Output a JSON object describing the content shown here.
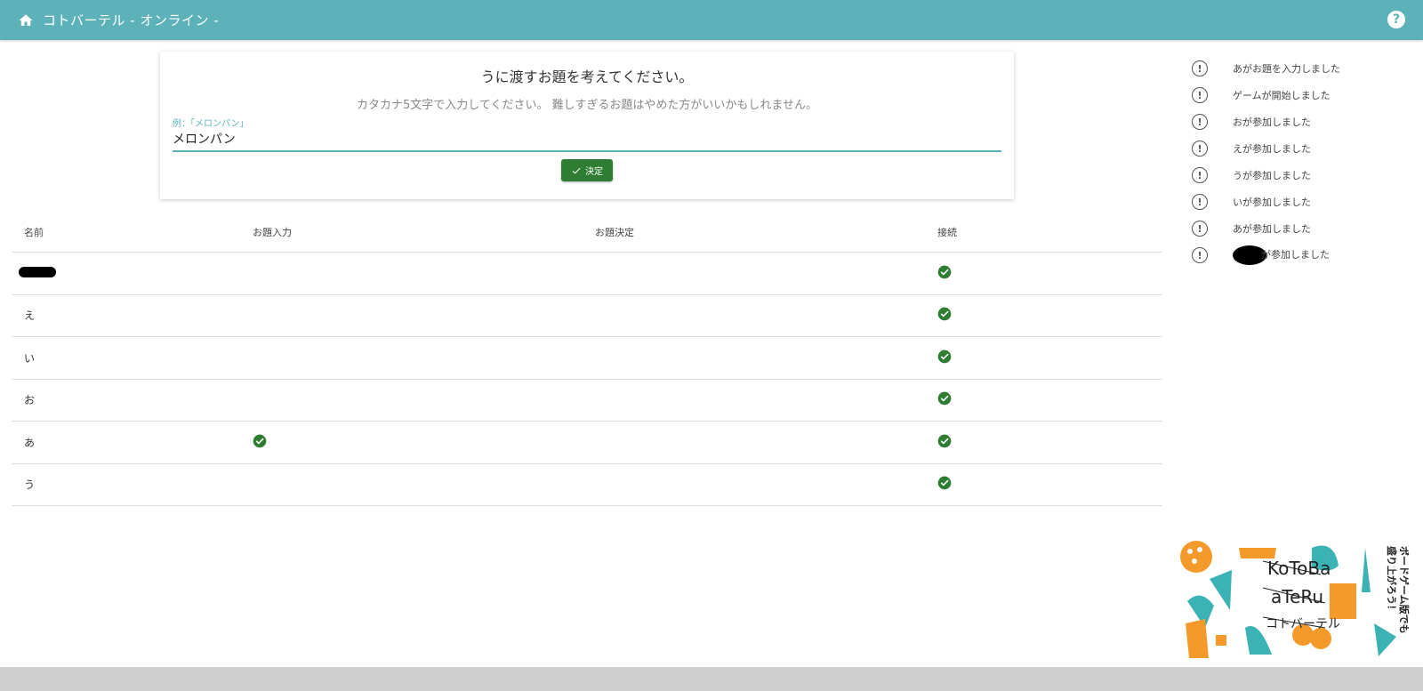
{
  "appbar": {
    "title": "コトバーテル - オンライン -",
    "home_icon": "home-icon",
    "help_icon": "help-icon",
    "help_glyph": "?"
  },
  "prompt_card": {
    "heading": "うに渡すお題を考えてください。",
    "subtext": "カタカナ5文字で入力してください。 難しすぎるお題はやめた方がいいかもしれません。",
    "field_label": "例：「メロンパン」",
    "field_value": "メロンパン",
    "submit_label": "決定"
  },
  "table": {
    "headers": [
      "名前",
      "お題入力",
      "お題決定",
      "接続"
    ],
    "rows": [
      {
        "name": "",
        "redacted": true,
        "topic_input": false,
        "topic_decided": false,
        "connected": true
      },
      {
        "name": "え",
        "redacted": false,
        "topic_input": false,
        "topic_decided": false,
        "connected": true
      },
      {
        "name": "い",
        "redacted": false,
        "topic_input": false,
        "topic_decided": false,
        "connected": true
      },
      {
        "name": "お",
        "redacted": false,
        "topic_input": false,
        "topic_decided": false,
        "connected": true
      },
      {
        "name": "あ",
        "redacted": false,
        "topic_input": true,
        "topic_decided": false,
        "connected": true
      },
      {
        "name": "う",
        "redacted": false,
        "topic_input": false,
        "topic_decided": false,
        "connected": true
      }
    ]
  },
  "activity_feed": {
    "info_glyph": "!",
    "items": [
      {
        "text": "あがお題を入力しました"
      },
      {
        "text": "ゲームが開始しました"
      },
      {
        "text": "おが参加しました"
      },
      {
        "text": "えが参加しました"
      },
      {
        "text": "うが参加しました"
      },
      {
        "text": "いが参加しました"
      },
      {
        "text": "あが参加しました"
      },
      {
        "text": "が参加しました",
        "redacted_prefix": true
      }
    ]
  },
  "logo": {
    "line1": "KoToBa",
    "line2": "aTeRu",
    "line3": "コトバーテル",
    "tagline_line1": "ボードゲーム版でも",
    "tagline_line2": "盛り上がろう！"
  },
  "colors": {
    "primary": "#5db1b8",
    "success": "#2e7d32",
    "accent_orange": "#f39a2a",
    "footer": "#cfcfcf"
  }
}
